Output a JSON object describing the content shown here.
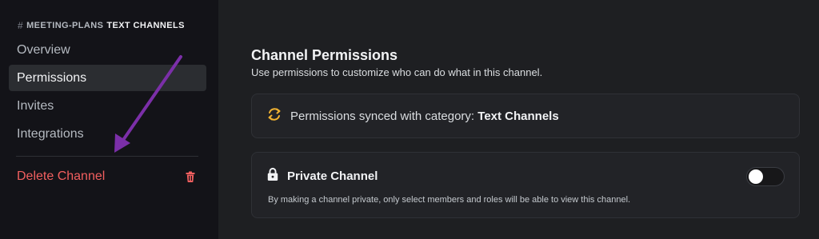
{
  "sidebar": {
    "channel_name": "MEETING-PLANS",
    "category": "TEXT CHANNELS",
    "items": [
      {
        "label": "Overview",
        "active": false
      },
      {
        "label": "Permissions",
        "active": true
      },
      {
        "label": "Invites",
        "active": false
      },
      {
        "label": "Integrations",
        "active": false
      }
    ],
    "delete_label": "Delete Channel"
  },
  "main": {
    "title": "Channel Permissions",
    "subtitle": "Use permissions to customize who can do what in this channel.",
    "sync": {
      "prefix": "Permissions synced with category: ",
      "category": "Text Channels"
    },
    "private_channel": {
      "title": "Private Channel",
      "description": "By making a channel private, only select members and roles will be able to view this channel.",
      "enabled": false
    }
  },
  "colors": {
    "sidebar_bg": "#131318",
    "main_bg": "#1e1f22",
    "danger": "#f25f5f",
    "sync_icon": "#f0b232",
    "annotation_arrow": "#7b2fa8"
  }
}
